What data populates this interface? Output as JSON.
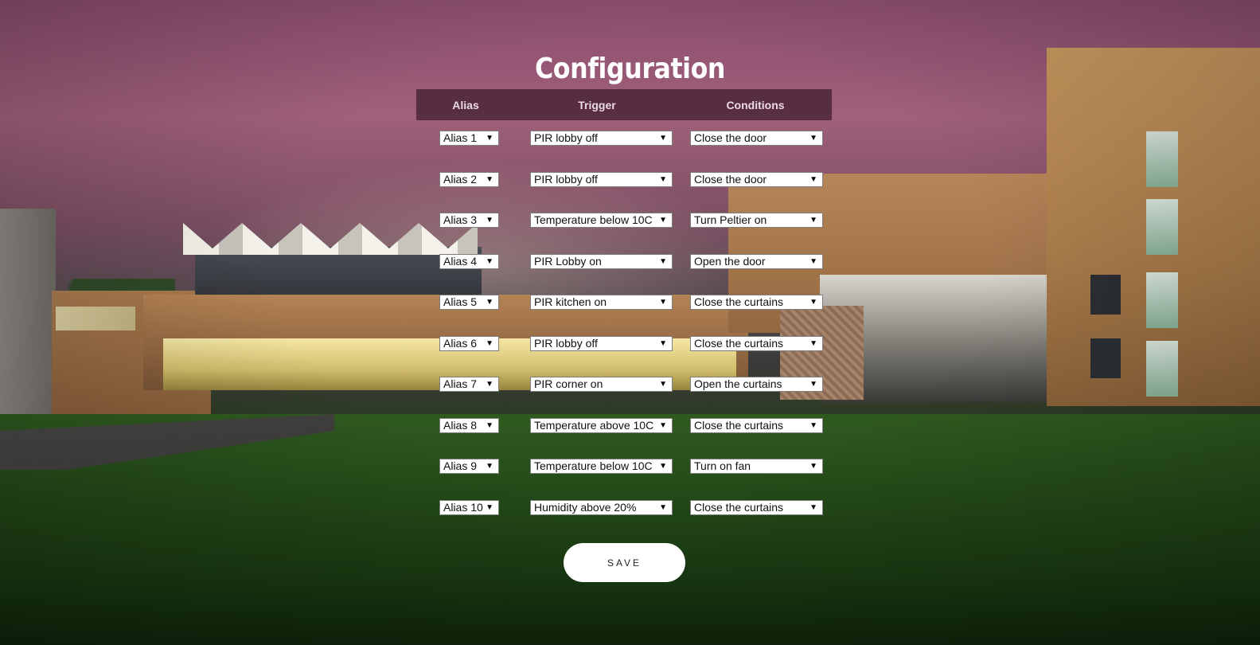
{
  "page": {
    "title": "Configuration"
  },
  "table": {
    "headers": {
      "alias": "Alias",
      "trigger": "Trigger",
      "conditions": "Conditions"
    },
    "rows": [
      {
        "alias": "Alias 1",
        "trigger": "PIR lobby off",
        "condition": "Close the door"
      },
      {
        "alias": "Alias 2",
        "trigger": "PIR lobby off",
        "condition": "Close the door"
      },
      {
        "alias": "Alias 3",
        "trigger": "Temperature below 10C",
        "condition": "Turn Peltier on"
      },
      {
        "alias": "Alias 4",
        "trigger": "PIR Lobby on",
        "condition": "Open the door"
      },
      {
        "alias": "Alias 5",
        "trigger": "PIR kitchen on",
        "condition": "Close the curtains"
      },
      {
        "alias": "Alias 6",
        "trigger": "PIR lobby off",
        "condition": "Close the curtains"
      },
      {
        "alias": "Alias 7",
        "trigger": "PIR corner on",
        "condition": "Open the curtains"
      },
      {
        "alias": "Alias 8",
        "trigger": "Temperature above 10C",
        "condition": "Close the curtains"
      },
      {
        "alias": "Alias 9",
        "trigger": "Temperature below 10C",
        "condition": "Turn on fan"
      },
      {
        "alias": "Alias 10",
        "trigger": "Humidity above 20%",
        "condition": "Close the curtains"
      }
    ],
    "dropdown_arrow": "▼"
  },
  "actions": {
    "save_label": "SAVE"
  },
  "background": {
    "description_icon": "campus-night-photo"
  }
}
